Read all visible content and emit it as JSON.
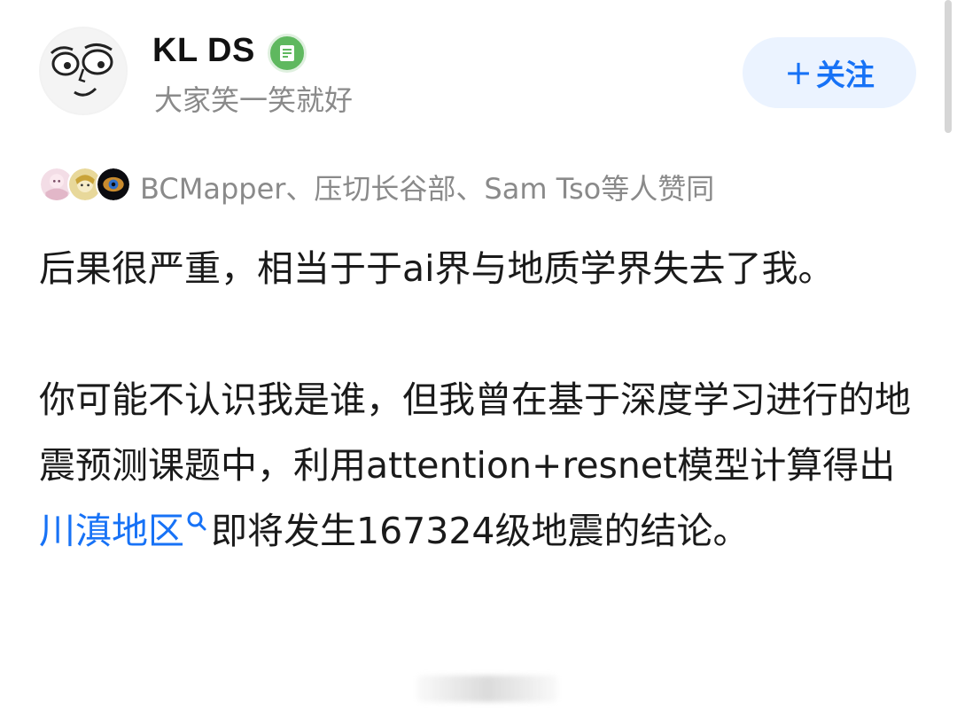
{
  "author": {
    "name": "KL DS",
    "bio": "大家笑一笑就好",
    "avatar_icon": "meme-face-avatar",
    "badge_icon": "certified-badge-icon"
  },
  "follow_button": {
    "label": "关注",
    "plus": "+"
  },
  "likers": {
    "text": "BCMapper、压切长谷部、Sam Tso等人赞同",
    "avatars": [
      "anime-girl-avatar",
      "blonde-character-avatar",
      "galaxy-eye-avatar"
    ]
  },
  "body": {
    "para1": "后果很严重，相当于于ai界与地质学界失去了我。",
    "para2_before": "你可能不认识我是谁，但我曾在基于深度学习进行的地震预测课题中，利用attention+resnet模型计算得出",
    "para2_link": "川滇地区",
    "para2_after": "即将发生167324级地震的结论。"
  },
  "colors": {
    "accent": "#1772f6",
    "follow_bg": "#ebf3ff",
    "muted_text": "#8a8a8a",
    "badge_green": "#5fb85f"
  }
}
